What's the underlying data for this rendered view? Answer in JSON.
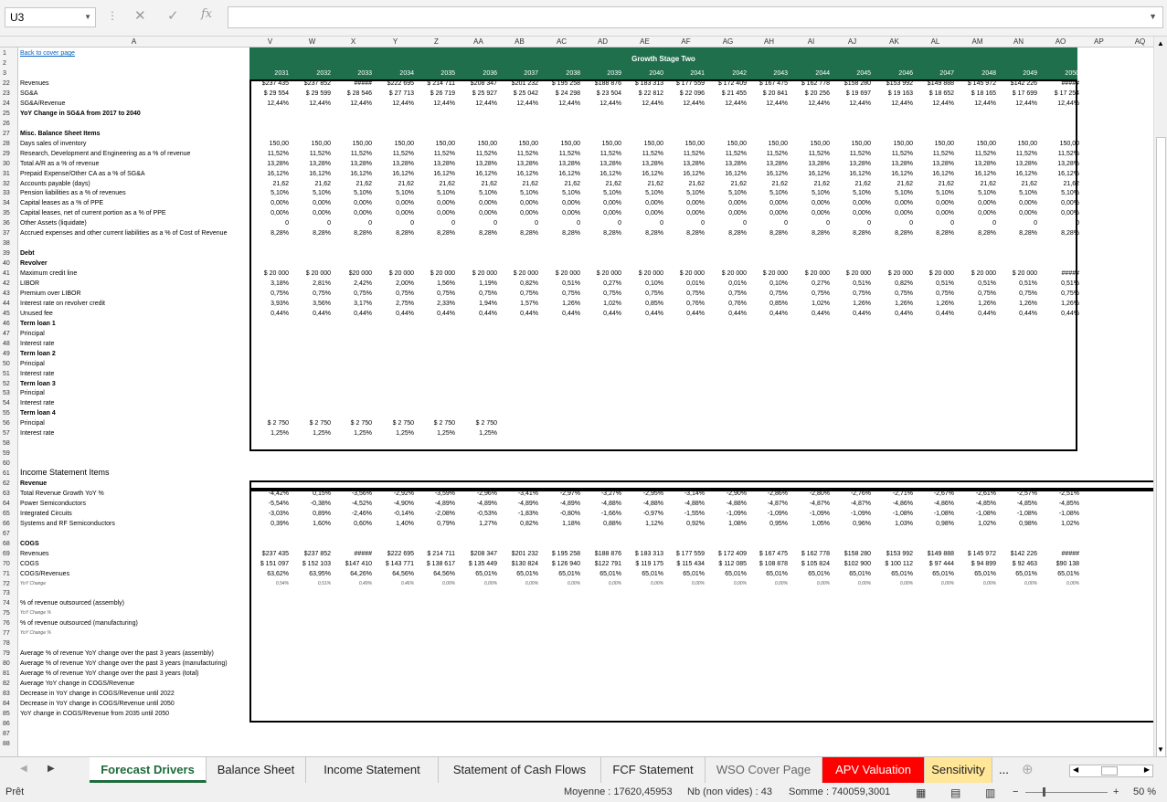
{
  "namebox": "U3",
  "formula": "",
  "columns": [
    "A",
    "V",
    "W",
    "X",
    "Y",
    "Z",
    "AA",
    "AB",
    "AC",
    "AD",
    "AE",
    "AF",
    "AG",
    "AH",
    "AI",
    "AJ",
    "AK",
    "AL",
    "AM",
    "AN",
    "AO",
    "AP",
    "AQ"
  ],
  "banner": "Growth Stage Two",
  "back_link": "Back to cover page",
  "years": [
    "2031",
    "2032",
    "2033",
    "2034",
    "2035",
    "2036",
    "2037",
    "2038",
    "2039",
    "2040",
    "2041",
    "2042",
    "2043",
    "2044",
    "2045",
    "2046",
    "2047",
    "2048",
    "2049",
    "2050"
  ],
  "rows": [
    {
      "n": "22",
      "label": "Revenues",
      "v": [
        "$237 435",
        "$237 852",
        "#####",
        "$222 695",
        "$ 214 711",
        "$208 347",
        "$201 232",
        "$ 195 258",
        "$188 876",
        "$ 183 313",
        "$ 177 559",
        "$ 172 409",
        "$ 167 475",
        "$ 162 778",
        "$158 280",
        "$153 992",
        "$149 888",
        "$ 145 972",
        "$142 226",
        "#####"
      ]
    },
    {
      "n": "23",
      "label": "SG&A",
      "v": [
        "$ 29 554",
        "$ 29 599",
        "$ 28 546",
        "$ 27 713",
        "$ 26 719",
        "$ 25 927",
        "$ 25 042",
        "$ 24 298",
        "$ 23 504",
        "$ 22 812",
        "$ 22 096",
        "$ 21 455",
        "$ 20 841",
        "$ 20 256",
        "$ 19 697",
        "$ 19 163",
        "$ 18 652",
        "$ 18 165",
        "$ 17 699",
        "$ 17 254"
      ]
    },
    {
      "n": "24",
      "label": "SG&A/Revenue",
      "v": [
        "12,44%",
        "12,44%",
        "12,44%",
        "12,44%",
        "12,44%",
        "12,44%",
        "12,44%",
        "12,44%",
        "12,44%",
        "12,44%",
        "12,44%",
        "12,44%",
        "12,44%",
        "12,44%",
        "12,44%",
        "12,44%",
        "12,44%",
        "12,44%",
        "12,44%",
        "12,44%"
      ]
    },
    {
      "n": "25",
      "label": "YoY Change in SG&A from 2017 to 2040",
      "bold": true,
      "v": []
    },
    {
      "n": "26",
      "label": "",
      "v": []
    },
    {
      "n": "27",
      "label": "Misc. Balance Sheet Items",
      "bold": true,
      "v": []
    },
    {
      "n": "28",
      "label": "Days sales of inventory",
      "v": [
        "150,00",
        "150,00",
        "150,00",
        "150,00",
        "150,00",
        "150,00",
        "150,00",
        "150,00",
        "150,00",
        "150,00",
        "150,00",
        "150,00",
        "150,00",
        "150,00",
        "150,00",
        "150,00",
        "150,00",
        "150,00",
        "150,00",
        "150,00"
      ]
    },
    {
      "n": "29",
      "label": "Research, Development and Engineering as a % of revenue",
      "v": [
        "11,52%",
        "11,52%",
        "11,52%",
        "11,52%",
        "11,52%",
        "11,52%",
        "11,52%",
        "11,52%",
        "11,52%",
        "11,52%",
        "11,52%",
        "11,52%",
        "11,52%",
        "11,52%",
        "11,52%",
        "11,52%",
        "11,52%",
        "11,52%",
        "11,52%",
        "11,52%"
      ]
    },
    {
      "n": "30",
      "label": "Total A/R as a % of revenue",
      "v": [
        "13,28%",
        "13,28%",
        "13,28%",
        "13,28%",
        "13,28%",
        "13,28%",
        "13,28%",
        "13,28%",
        "13,28%",
        "13,28%",
        "13,28%",
        "13,28%",
        "13,28%",
        "13,28%",
        "13,28%",
        "13,28%",
        "13,28%",
        "13,28%",
        "13,28%",
        "13,28%"
      ]
    },
    {
      "n": "31",
      "label": "Prepaid Expense/Other CA as a % of SG&A",
      "v": [
        "16,12%",
        "16,12%",
        "16,12%",
        "16,12%",
        "16,12%",
        "16,12%",
        "16,12%",
        "16,12%",
        "16,12%",
        "16,12%",
        "16,12%",
        "16,12%",
        "16,12%",
        "16,12%",
        "16,12%",
        "16,12%",
        "16,12%",
        "16,12%",
        "16,12%",
        "16,12%"
      ]
    },
    {
      "n": "32",
      "label": "Accounts payable (days)",
      "v": [
        "21,62",
        "21,62",
        "21,62",
        "21,62",
        "21,62",
        "21,62",
        "21,62",
        "21,62",
        "21,62",
        "21,62",
        "21,62",
        "21,62",
        "21,62",
        "21,62",
        "21,62",
        "21,62",
        "21,62",
        "21,62",
        "21,62",
        "21,62"
      ]
    },
    {
      "n": "33",
      "label": "Pension liabilities as a % of revenues",
      "v": [
        "5,10%",
        "5,10%",
        "5,10%",
        "5,10%",
        "5,10%",
        "5,10%",
        "5,10%",
        "5,10%",
        "5,10%",
        "5,10%",
        "5,10%",
        "5,10%",
        "5,10%",
        "5,10%",
        "5,10%",
        "5,10%",
        "5,10%",
        "5,10%",
        "5,10%",
        "5,10%"
      ]
    },
    {
      "n": "34",
      "label": "Capital leases as a % of PPE",
      "v": [
        "0,00%",
        "0,00%",
        "0,00%",
        "0,00%",
        "0,00%",
        "0,00%",
        "0,00%",
        "0,00%",
        "0,00%",
        "0,00%",
        "0,00%",
        "0,00%",
        "0,00%",
        "0,00%",
        "0,00%",
        "0,00%",
        "0,00%",
        "0,00%",
        "0,00%",
        "0,00%"
      ]
    },
    {
      "n": "35",
      "label": "Capital leases, net of current portion as a % of PPE",
      "v": [
        "0,00%",
        "0,00%",
        "0,00%",
        "0,00%",
        "0,00%",
        "0,00%",
        "0,00%",
        "0,00%",
        "0,00%",
        "0,00%",
        "0,00%",
        "0,00%",
        "0,00%",
        "0,00%",
        "0,00%",
        "0,00%",
        "0,00%",
        "0,00%",
        "0,00%",
        "0,00%"
      ]
    },
    {
      "n": "36",
      "label": "Other Assets (liquidate)",
      "v": [
        "0",
        "0",
        "0",
        "0",
        "0",
        "0",
        "0",
        "0",
        "0",
        "0",
        "0",
        "0",
        "0",
        "0",
        "0",
        "0",
        "0",
        "0",
        "0",
        "0"
      ]
    },
    {
      "n": "37",
      "label": "Accrued expenses and other current liabilities as a % of Cost of Revenue",
      "v": [
        "8,28%",
        "8,28%",
        "8,28%",
        "8,28%",
        "8,28%",
        "8,28%",
        "8,28%",
        "8,28%",
        "8,28%",
        "8,28%",
        "8,28%",
        "8,28%",
        "8,28%",
        "8,28%",
        "8,28%",
        "8,28%",
        "8,28%",
        "8,28%",
        "8,28%",
        "8,28%"
      ]
    },
    {
      "n": "38",
      "label": "",
      "v": []
    },
    {
      "n": "39",
      "label": "Debt",
      "bold": true,
      "v": []
    },
    {
      "n": "40",
      "label": "Revolver",
      "bold": true,
      "v": []
    },
    {
      "n": "41",
      "label": "   Maximum credit line",
      "v": [
        "$ 20 000",
        "$ 20 000",
        "$20 000",
        "$ 20 000",
        "$ 20 000",
        "$ 20 000",
        "$ 20 000",
        "$ 20 000",
        "$ 20 000",
        "$ 20 000",
        "$ 20 000",
        "$ 20 000",
        "$ 20 000",
        "$ 20 000",
        "$ 20 000",
        "$ 20 000",
        "$ 20 000",
        "$ 20 000",
        "$ 20 000",
        "#####"
      ]
    },
    {
      "n": "42",
      "label": "   LIBOR",
      "v": [
        "3,18%",
        "2,81%",
        "2,42%",
        "2,00%",
        "1,56%",
        "1,19%",
        "0,82%",
        "0,51%",
        "0,27%",
        "0,10%",
        "0,01%",
        "0,01%",
        "0,10%",
        "0,27%",
        "0,51%",
        "0,82%",
        "0,51%",
        "0,51%",
        "0,51%",
        "0,51%"
      ]
    },
    {
      "n": "43",
      "label": "   Premium over LIBOR",
      "v": [
        "0,75%",
        "0,75%",
        "0,75%",
        "0,75%",
        "0,75%",
        "0,75%",
        "0,75%",
        "0,75%",
        "0,75%",
        "0,75%",
        "0,75%",
        "0,75%",
        "0,75%",
        "0,75%",
        "0,75%",
        "0,75%",
        "0,75%",
        "0,75%",
        "0,75%",
        "0,75%"
      ]
    },
    {
      "n": "44",
      "label": "   Interest rate on revolver credit",
      "v": [
        "3,93%",
        "3,56%",
        "3,17%",
        "2,75%",
        "2,33%",
        "1,94%",
        "1,57%",
        "1,26%",
        "1,02%",
        "0,85%",
        "0,76%",
        "0,76%",
        "0,85%",
        "1,02%",
        "1,26%",
        "1,26%",
        "1,26%",
        "1,26%",
        "1,26%",
        "1,26%"
      ]
    },
    {
      "n": "45",
      "label": "   Unused fee",
      "v": [
        "0,44%",
        "0,44%",
        "0,44%",
        "0,44%",
        "0,44%",
        "0,44%",
        "0,44%",
        "0,44%",
        "0,44%",
        "0,44%",
        "0,44%",
        "0,44%",
        "0,44%",
        "0,44%",
        "0,44%",
        "0,44%",
        "0,44%",
        "0,44%",
        "0,44%",
        "0,44%"
      ]
    },
    {
      "n": "46",
      "label": "Term loan 1",
      "bold": true,
      "v": []
    },
    {
      "n": "47",
      "label": "   Principal",
      "v": []
    },
    {
      "n": "48",
      "label": "   Interest rate",
      "v": []
    },
    {
      "n": "49",
      "label": "Term loan 2",
      "bold": true,
      "v": []
    },
    {
      "n": "50",
      "label": "   Principal",
      "v": []
    },
    {
      "n": "51",
      "label": "   Interest rate",
      "v": []
    },
    {
      "n": "52",
      "label": "Term loan 3",
      "bold": true,
      "v": []
    },
    {
      "n": "53",
      "label": "   Principal",
      "v": []
    },
    {
      "n": "54",
      "label": "   Interest rate",
      "v": []
    },
    {
      "n": "55",
      "label": "Term loan 4",
      "bold": true,
      "v": []
    },
    {
      "n": "56",
      "label": "   Principal",
      "v": [
        "$ 2 750",
        "$ 2 750",
        "$ 2 750",
        "$ 2 750",
        "$ 2 750",
        "$ 2 750"
      ]
    },
    {
      "n": "57",
      "label": "   Interest rate",
      "v": [
        "1,25%",
        "1,25%",
        "1,25%",
        "1,25%",
        "1,25%",
        "1,25%"
      ]
    },
    {
      "n": "58",
      "label": "",
      "v": []
    },
    {
      "n": "59",
      "label": "",
      "v": []
    },
    {
      "n": "60",
      "label": "",
      "v": []
    },
    {
      "n": "61",
      "label": "Income Statement Items",
      "big": true,
      "v": []
    },
    {
      "n": "62",
      "label": "Revenue",
      "bold": true,
      "v": []
    },
    {
      "n": "63",
      "label": "Total Revenue Growth YoY %",
      "v": [
        "-4,42%",
        "0,15%",
        "-3,56%",
        "-2,92%",
        "-3,59%",
        "-2,96%",
        "-3,41%",
        "-2,97%",
        "-3,27%",
        "-2,95%",
        "-3,14%",
        "-2,90%",
        "-2,86%",
        "-2,80%",
        "-2,76%",
        "-2,71%",
        "-2,67%",
        "-2,61%",
        "-2,57%",
        "-2,51%"
      ]
    },
    {
      "n": "64",
      "label": "   Power Semiconductors",
      "v": [
        "-5,54%",
        "-0,38%",
        "-4,52%",
        "-4,90%",
        "-4,89%",
        "-4,89%",
        "-4,89%",
        "-4,89%",
        "-4,88%",
        "-4,88%",
        "-4,88%",
        "-4,88%",
        "-4,87%",
        "-4,87%",
        "-4,87%",
        "-4,86%",
        "-4,86%",
        "-4,85%",
        "-4,85%",
        "-4,85%"
      ]
    },
    {
      "n": "65",
      "label": "   Integrated Circuits",
      "v": [
        "-3,03%",
        "0,89%",
        "-2,46%",
        "-0,14%",
        "-2,08%",
        "-0,53%",
        "-1,83%",
        "-0,80%",
        "-1,66%",
        "-0,97%",
        "-1,55%",
        "-1,09%",
        "-1,09%",
        "-1,09%",
        "-1,09%",
        "-1,08%",
        "-1,08%",
        "-1,08%",
        "-1,08%",
        "-1,08%"
      ]
    },
    {
      "n": "66",
      "label": "   Systems and RF Semiconductors",
      "v": [
        "0,39%",
        "1,60%",
        "0,60%",
        "1,40%",
        "0,79%",
        "1,27%",
        "0,82%",
        "1,18%",
        "0,88%",
        "1,12%",
        "0,92%",
        "1,08%",
        "0,95%",
        "1,05%",
        "0,96%",
        "1,03%",
        "0,98%",
        "1,02%",
        "0,98%",
        "1,02%"
      ]
    },
    {
      "n": "67",
      "label": "",
      "v": []
    },
    {
      "n": "68",
      "label": "COGS",
      "bold": true,
      "v": []
    },
    {
      "n": "69",
      "label": "Revenues",
      "v": [
        "$237 435",
        "$237 852",
        "#####",
        "$222 695",
        "$ 214 711",
        "$208 347",
        "$201 232",
        "$ 195 258",
        "$188 876",
        "$ 183 313",
        "$ 177 559",
        "$ 172 409",
        "$ 167 475",
        "$ 162 778",
        "$158 280",
        "$153 992",
        "$149 888",
        "$ 145 972",
        "$142 226",
        "#####"
      ]
    },
    {
      "n": "70",
      "label": "COGS",
      "v": [
        "$ 151 097",
        "$ 152 103",
        "$147 410",
        "$ 143 771",
        "$ 138 617",
        "$ 135 449",
        "$130 824",
        "$ 126 940",
        "$122 791",
        "$ 119 175",
        "$ 115 434",
        "$ 112 085",
        "$ 108 878",
        "$ 105 824",
        "$102 900",
        "$ 100 112",
        "$ 97 444",
        "$ 94 899",
        "$ 92 463",
        "$90 138"
      ]
    },
    {
      "n": "71",
      "label": "COGS/Revenues",
      "v": [
        "63,62%",
        "63,95%",
        "64,26%",
        "64,56%",
        "64,56%",
        "65,01%",
        "65,01%",
        "65,01%",
        "65,01%",
        "65,01%",
        "65,01%",
        "65,01%",
        "65,01%",
        "65,01%",
        "65,01%",
        "65,01%",
        "65,01%",
        "65,01%",
        "65,01%",
        "65,01%"
      ]
    },
    {
      "n": "72",
      "label": "   YoY Change",
      "small": true,
      "v": [
        "0,54%",
        "0,51%",
        "0,49%",
        "0,46%",
        "0,00%",
        "0,00%",
        "0,00%",
        "0,00%",
        "0,00%",
        "0,00%",
        "0,00%",
        "0,00%",
        "0,00%",
        "0,00%",
        "0,00%",
        "0,00%",
        "0,00%",
        "0,00%",
        "0,00%",
        "0,00%"
      ]
    },
    {
      "n": "73",
      "label": "",
      "v": []
    },
    {
      "n": "74",
      "label": "% of revenue outsourced (assembly)",
      "v": []
    },
    {
      "n": "75",
      "label": "   YoY Change %",
      "small": true,
      "v": []
    },
    {
      "n": "76",
      "label": "% of revenue outsourced (manufacturing)",
      "v": []
    },
    {
      "n": "77",
      "label": "   YoY Change %",
      "small": true,
      "v": []
    },
    {
      "n": "78",
      "label": "",
      "v": []
    },
    {
      "n": "79",
      "label": "Average % of revenue YoY change over the past 3 years (assembly)",
      "v": []
    },
    {
      "n": "80",
      "label": "Average % of revenue YoY change over the past 3 years (manufacturing)",
      "v": []
    },
    {
      "n": "81",
      "label": "Average % of revenue YoY change over the past 3 years (total)",
      "v": []
    },
    {
      "n": "82",
      "label": "Average YoY change in COGS/Revenue",
      "v": []
    },
    {
      "n": "83",
      "label": "Decrease in YoY change in COGS/Revenue until 2022",
      "v": []
    },
    {
      "n": "84",
      "label": "Decrease in YoY change in COGS/Revenue until 2050",
      "v": []
    },
    {
      "n": "85",
      "label": "YoY change in COGS/Revenue from 2035 until 2050",
      "v": []
    },
    {
      "n": "86",
      "label": "",
      "v": []
    },
    {
      "n": "87",
      "label": "",
      "v": []
    },
    {
      "n": "88",
      "label": "",
      "v": []
    }
  ],
  "tabs": [
    "Forecast Drivers",
    "Balance Sheet",
    "Income Statement",
    "Statement of Cash Flows",
    "FCF Statement",
    "WSO Cover Page",
    "APV Valuation",
    "Sensitivity"
  ],
  "tab_more": "...",
  "status": {
    "ready": "Prêt",
    "average": "Moyenne : 17620,45953",
    "count": "Nb (non vides) : 43",
    "sum": "Somme : 740059,3001",
    "zoom": "50 %"
  },
  "colors": {
    "banner": "#1f6f4d",
    "active_tab": "#1e6b3c",
    "apv_tab": "#ff0000",
    "sens_tab": "#ffe699"
  }
}
